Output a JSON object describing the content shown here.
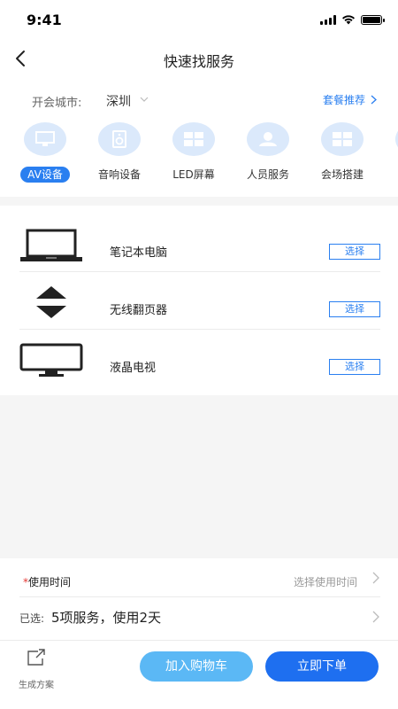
{
  "status_bar": {
    "time": "9:41"
  },
  "nav": {
    "title": "快速找服务",
    "back_icon": "chevron-left-icon"
  },
  "city": {
    "label": "开会城市:",
    "value": "深圳",
    "package_link": "套餐推荐"
  },
  "categories": [
    {
      "label": "AV设备",
      "icon": "monitor-icon",
      "active": true
    },
    {
      "label": "音响设备",
      "icon": "speaker-icon",
      "active": false
    },
    {
      "label": "LED屏幕",
      "icon": "led-grid-icon",
      "active": false
    },
    {
      "label": "人员服务",
      "icon": "staff-icon",
      "active": false
    },
    {
      "label": "会场搭建",
      "icon": "venue-grid-icon",
      "active": false
    }
  ],
  "items": [
    {
      "name": "笔记本电脑",
      "icon": "laptop-icon",
      "action": "选择"
    },
    {
      "name": "无线翻页器",
      "icon": "pager-arrows-icon",
      "action": "选择"
    },
    {
      "name": "液晶电视",
      "icon": "tv-icon",
      "action": "选择"
    }
  ],
  "usage": {
    "required_mark": "*",
    "time_label": "使用时间",
    "time_placeholder": "选择使用时间",
    "selected_prefix": "已选:",
    "selected_text": "5项服务，使用2天"
  },
  "bottom_bar": {
    "generate_label": "生成方案",
    "cart_label": "加入购物车",
    "order_label": "立即下单"
  },
  "colors": {
    "accent": "#2a7ff0",
    "cart_button": "#5bb8f5",
    "order_button": "#1e6ff0",
    "category_bg": "#dbe9fb"
  }
}
